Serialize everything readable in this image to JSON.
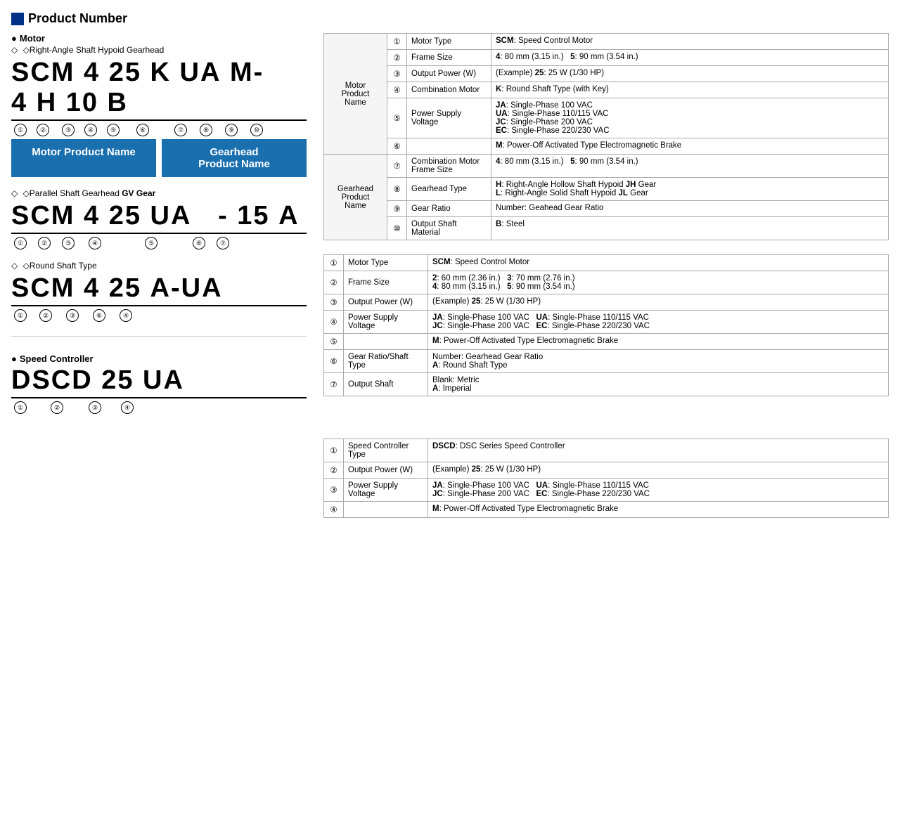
{
  "page": {
    "section_title": "Product Number",
    "motor_label": "Motor",
    "gearhead_right_angle_label": "Right-Angle Shaft Hypoid Gearhead",
    "code_right_angle": {
      "display": "SCM 4 25 K UA M - 4 H 10 B",
      "segments": [
        "SCM",
        "4",
        "25",
        "K",
        "UA",
        "M",
        "-",
        "4",
        "H",
        "10",
        "B"
      ],
      "circles": [
        "①",
        "②",
        "③",
        "④",
        "⑤",
        "⑥",
        "",
        "⑦",
        "⑧",
        "⑨",
        "⑩"
      ]
    },
    "motor_product_name_label": "Motor Product Name",
    "gearhead_product_name_label": "Gearhead\nProduct Name",
    "gearhead_parallel_label": "Parallel Shaft Gearhead GV Gear",
    "code_parallel": {
      "display": "SCM 4 25 UA   - 15 A",
      "circles_labels": [
        "①",
        "②",
        "③",
        "④",
        "⑤",
        "",
        "⑥",
        "⑦"
      ]
    },
    "round_shaft_label": "Round Shaft Type",
    "code_round": {
      "display": "SCM 4 25 A - UA",
      "circles_labels": [
        "①",
        "②",
        "③",
        "⑥",
        "④"
      ]
    },
    "speed_controller_label": "Speed Controller",
    "code_speed": {
      "display": "DSCD 25 UA",
      "circles_labels": [
        "①",
        "②",
        "③",
        "④"
      ]
    },
    "table_right_angle": {
      "rows": [
        {
          "group": "Motor\nProduct\nName",
          "num": "①",
          "key": "Motor Type",
          "value": "<b>SCM</b>: Speed Control Motor"
        },
        {
          "group": "",
          "num": "②",
          "key": "Frame Size",
          "value": "<b>4</b>: 80 mm (3.15 in.)   <b>5</b>: 90 mm (3.54 in.)"
        },
        {
          "group": "",
          "num": "③",
          "key": "Output Power (W)",
          "value": "(Example) <b>25</b>: 25 W (1/30 HP)"
        },
        {
          "group": "",
          "num": "④",
          "key": "Combination Motor",
          "value": "<b>K</b>: Round Shaft Type (with Key)"
        },
        {
          "group": "",
          "num": "⑤",
          "key": "Power Supply Voltage",
          "value": "<b>JA</b>: Single-Phase 100 VAC\n<b>UA</b>: Single-Phase 110/115 VAC\n<b>JC</b>: Single-Phase 200 VAC\n<b>EC</b>: Single-Phase 220/230 VAC"
        },
        {
          "group": "",
          "num": "⑥",
          "key": "",
          "value": "<b>M</b>: Power-Off Activated Type Electromagnetic Brake"
        },
        {
          "group": "Gearhead\nProduct\nName",
          "num": "⑦",
          "key": "Combination Motor\nFrame Size",
          "value": "<b>4</b>: 80 mm (3.15 in.)   <b>5</b>: 90 mm (3.54 in.)"
        },
        {
          "group": "",
          "num": "⑧",
          "key": "Gearhead Type",
          "value": "<b>H</b>: Right-Angle Hollow Shaft Hypoid <b>JH</b> Gear\n<b>L</b>: Right-Angle Solid Shaft Hypoid <b>JL</b> Gear"
        },
        {
          "group": "",
          "num": "⑨",
          "key": "Gear Ratio",
          "value": "Number: Geahead Gear Ratio"
        },
        {
          "group": "",
          "num": "⑩",
          "key": "Output Shaft Material",
          "value": "<b>B</b>: Steel"
        }
      ]
    },
    "table_parallel": {
      "rows": [
        {
          "num": "①",
          "key": "Motor Type",
          "value": "<b>SCM</b>: Speed Control Motor"
        },
        {
          "num": "②",
          "key": "Frame Size",
          "value": "<b>2</b>: 60 mm (2.36 in.)   <b>3</b>: 70 mm (2.76 in.)\n<b>4</b>: 80 mm (3.15 in.)   <b>5</b>: 90 mm (3.54 in.)"
        },
        {
          "num": "③",
          "key": "Output Power (W)",
          "value": "(Example) <b>25</b>: 25 W (1/30 HP)"
        },
        {
          "num": "④",
          "key": "Power Supply Voltage",
          "value": "<b>JA</b>: Single-Phase 100 VAC   <b>UA</b>: Single-Phase 110/115 VAC\n<b>JC</b>: Single-Phase 200 VAC   <b>EC</b>: Single-Phase 220/230 VAC"
        },
        {
          "num": "⑤",
          "key": "",
          "value": "<b>M</b>: Power-Off Activated Type Electromagnetic Brake"
        },
        {
          "num": "⑥",
          "key": "Gear Ratio/Shaft\nType",
          "value": "Number: Gearhead Gear Ratio\n<b>A</b>: Round Shaft Type"
        },
        {
          "num": "⑦",
          "key": "Output Shaft",
          "value": "Blank: Metric\n<b>A</b>: Imperial"
        }
      ]
    },
    "table_speed": {
      "rows": [
        {
          "num": "①",
          "key": "Speed Controller\nType",
          "value": "<b>DSCD</b>: DSC Series Speed Controller"
        },
        {
          "num": "②",
          "key": "Output Power (W)",
          "value": "(Example) <b>25</b>: 25 W (1/30 HP)"
        },
        {
          "num": "③",
          "key": "Power Supply Voltage",
          "value": "<b>JA</b>: Single-Phase 100 VAC   <b>UA</b>: Single-Phase 110/115 VAC\n<b>JC</b>: Single-Phase 200 VAC   <b>EC</b>: Single-Phase 220/230 VAC"
        },
        {
          "num": "④",
          "key": "",
          "value": "<b>M</b>: Power-Off Activated Type Electromagnetic Brake"
        }
      ]
    }
  }
}
